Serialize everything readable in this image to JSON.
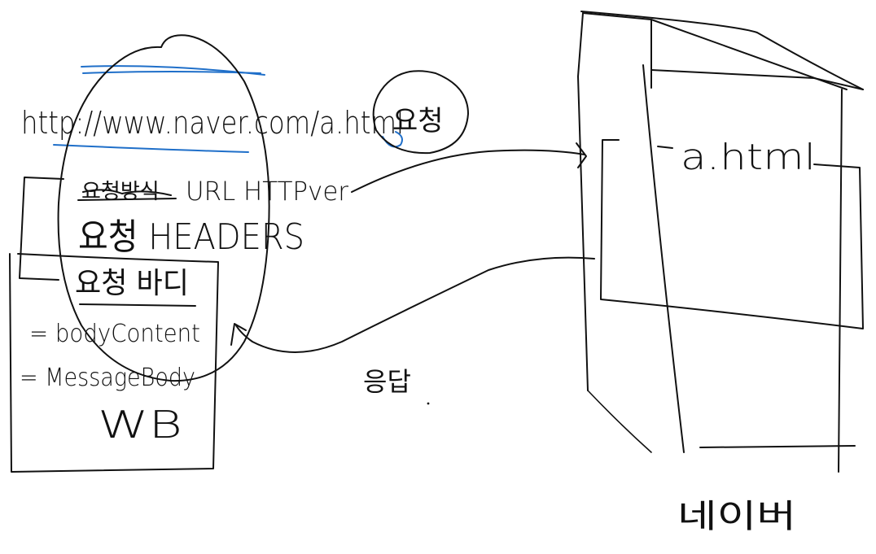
{
  "request_line": {
    "url_text": "http://www.naver.com/a.html",
    "request_label": "요청"
  },
  "request_message": {
    "method_label": "요청방식",
    "start_line_rest": "URL HTTPver",
    "headers_label": "요청 HEADERS",
    "body_label": "요청 바디",
    "body_alias_1": "= bodyContent",
    "body_alias_2": "= MessageBody",
    "body_abbrev": "WB"
  },
  "response_label": "응답",
  "server": {
    "file_label": "a.html",
    "caption": "네이버"
  },
  "colors": {
    "ink": "#111111",
    "highlight": "#1f6fc9",
    "background": "#ffffff"
  }
}
